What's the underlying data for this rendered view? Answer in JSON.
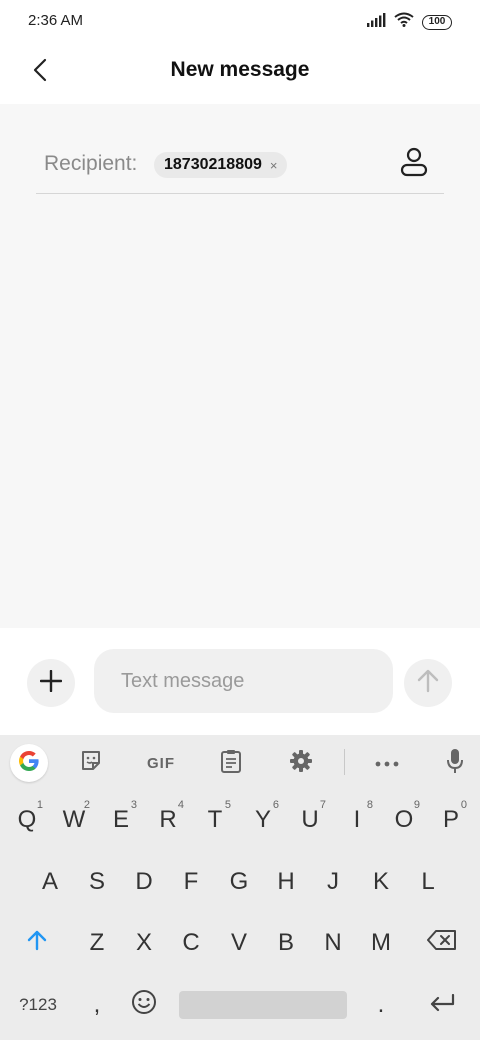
{
  "status": {
    "time": "2:36 AM",
    "battery": "100"
  },
  "header": {
    "title": "New message"
  },
  "recipient": {
    "label": "Recipient:",
    "chip_text": "18730218809",
    "chip_remove": "×"
  },
  "compose": {
    "placeholder": "Text message"
  },
  "keyboard": {
    "toolbar": {
      "gif_label": "GIF"
    },
    "row1": [
      {
        "label": "Q",
        "hint": "1"
      },
      {
        "label": "W",
        "hint": "2"
      },
      {
        "label": "E",
        "hint": "3"
      },
      {
        "label": "R",
        "hint": "4"
      },
      {
        "label": "T",
        "hint": "5"
      },
      {
        "label": "Y",
        "hint": "6"
      },
      {
        "label": "U",
        "hint": "7"
      },
      {
        "label": "I",
        "hint": "8"
      },
      {
        "label": "O",
        "hint": "9"
      },
      {
        "label": "P",
        "hint": "0"
      }
    ],
    "row2": [
      "A",
      "S",
      "D",
      "F",
      "G",
      "H",
      "J",
      "K",
      "L"
    ],
    "row3": [
      "Z",
      "X",
      "C",
      "V",
      "B",
      "N",
      "M"
    ],
    "row4": {
      "symbols": "?123",
      "comma": ",",
      "period": "."
    }
  },
  "colors": {
    "accent": "#2196f3",
    "content_bg": "#f7f7f7",
    "keyboard_bg": "#ececec"
  },
  "icons": {
    "back": "chevron-left-icon",
    "contact": "person-icon",
    "add": "plus-icon",
    "send": "arrow-up-icon",
    "google": "google-g-icon",
    "sticker": "sticker-icon",
    "clipboard": "clipboard-icon",
    "settings": "gear-icon",
    "more": "more-horizontal-icon",
    "mic": "microphone-icon",
    "shift": "shift-arrow-icon",
    "backspace": "backspace-icon",
    "emoji": "emoji-icon",
    "enter": "enter-icon"
  }
}
